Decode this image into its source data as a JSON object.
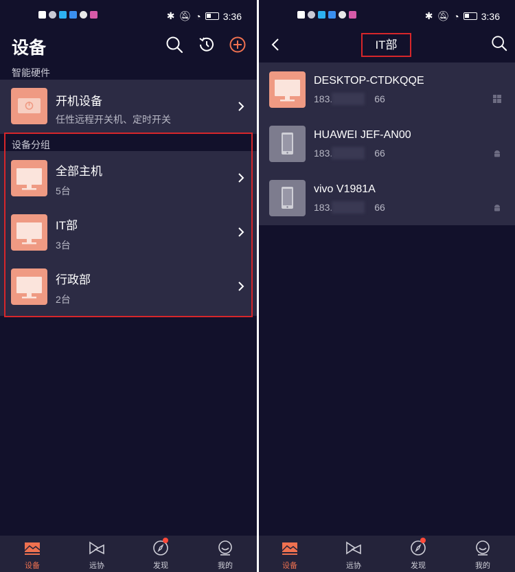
{
  "status": {
    "time": "3:36"
  },
  "left": {
    "title": "设备",
    "section_hardware": "智能硬件",
    "power_device": {
      "title": "开机设备",
      "subtitle": "任性远程开关机、定时开关"
    },
    "section_groups": "设备分组",
    "groups": [
      {
        "name": "全部主机",
        "count": "5台"
      },
      {
        "name": "IT部",
        "count": "3台"
      },
      {
        "name": "行政部",
        "count": "2台"
      }
    ]
  },
  "right": {
    "title": "IT部",
    "devices": [
      {
        "name": "DESKTOP-CTDKQQE",
        "ip_prefix": "183.",
        "ip_suffix": "66",
        "type": "desktop",
        "os": "windows-icon"
      },
      {
        "name": "HUAWEI JEF-AN00",
        "ip_prefix": "183.",
        "ip_suffix": "66",
        "type": "phone",
        "os": "android-icon"
      },
      {
        "name": "vivo V1981A",
        "ip_prefix": "183.",
        "ip_suffix": "66",
        "type": "phone",
        "os": "android-icon"
      }
    ]
  },
  "tabs": [
    {
      "label": "设备",
      "icon": "devices-icon",
      "active": true
    },
    {
      "label": "远协",
      "icon": "remote-assist-icon",
      "active": false
    },
    {
      "label": "发现",
      "icon": "compass-icon",
      "active": false
    },
    {
      "label": "我的",
      "icon": "profile-icon",
      "active": false
    }
  ],
  "colors": {
    "background": "#12112b",
    "card": "#2c2b44",
    "accent": "#ef7150",
    "thumb": "#ef9a83",
    "highlight": "#d7262a"
  }
}
